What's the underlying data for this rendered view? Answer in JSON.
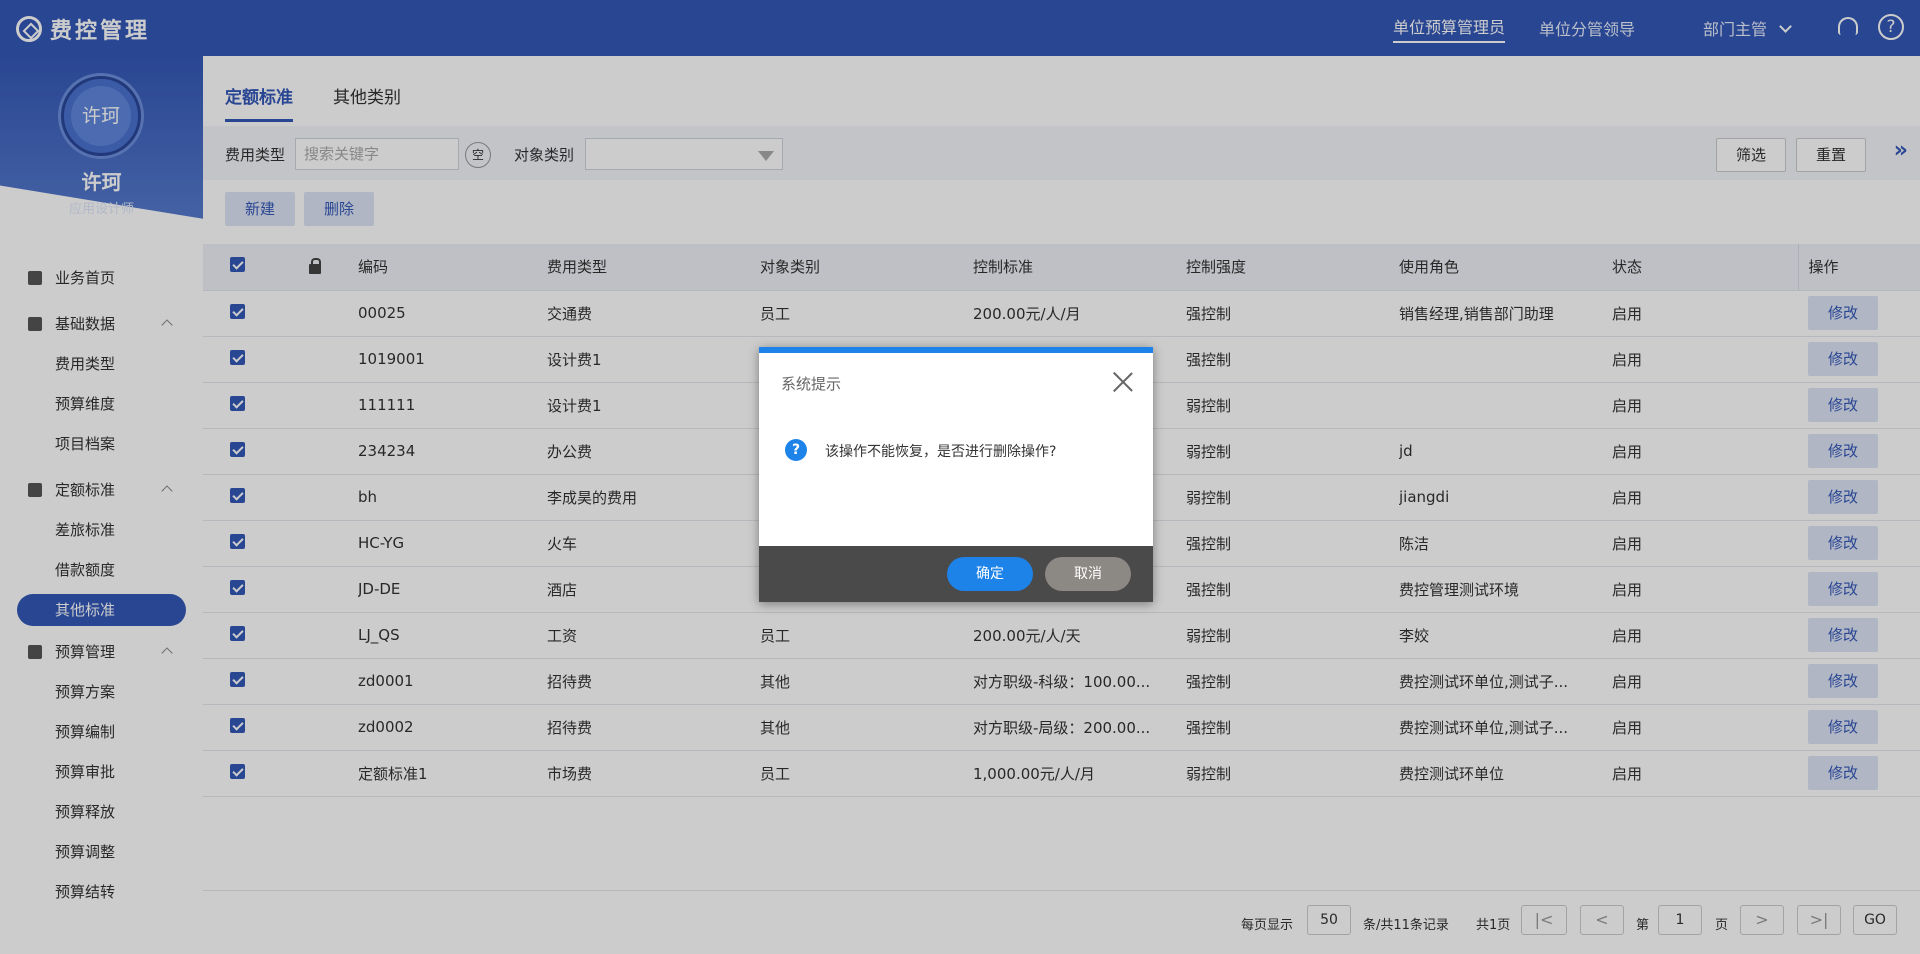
{
  "app": {
    "title": "费控管理"
  },
  "topnav": {
    "items": [
      "单位预算管理员",
      "单位分管领导",
      "部门主管"
    ]
  },
  "user": {
    "avatar_text": "许珂",
    "name": "许珂",
    "role": "应用设计师"
  },
  "sidebar": {
    "home": "业务首页",
    "groups": [
      {
        "label": "基础数据",
        "items": [
          "费用类型",
          "预算维度",
          "项目档案"
        ]
      },
      {
        "label": "定额标准",
        "items": [
          "差旅标准",
          "借款额度",
          "其他标准"
        ]
      },
      {
        "label": "预算管理",
        "items": [
          "预算方案",
          "预算编制",
          "预算审批",
          "预算释放",
          "预算调整",
          "预算结转"
        ]
      }
    ],
    "active_item": "其他标准"
  },
  "tabs": [
    "定额标准",
    "其他类别"
  ],
  "filter": {
    "expense_label": "费用类型",
    "expense_placeholder": "搜索关键字",
    "clear_label": "空",
    "object_label": "对象类别",
    "filter_btn": "筛选",
    "reset_btn": "重置",
    "expand": "»"
  },
  "actions": {
    "new": "新建",
    "delete": "删除"
  },
  "table": {
    "headers": [
      "编码",
      "费用类型",
      "对象类别",
      "控制标准",
      "控制强度",
      "使用角色",
      "状态",
      "操作"
    ],
    "edit_label": "修改",
    "rows": [
      [
        "00025",
        "交通费",
        "员工",
        "200.00元/人/月",
        "强控制",
        "销售经理,销售部门助理",
        "启用"
      ],
      [
        "1019001",
        "设计费1",
        "",
        "",
        "强控制",
        "",
        "启用"
      ],
      [
        "111111",
        "设计费1",
        "",
        "",
        "弱控制",
        "",
        "启用"
      ],
      [
        "234234",
        "办公费",
        "",
        "",
        "弱控制",
        "jd",
        "启用"
      ],
      [
        "bh",
        "李成昊的费用",
        "",
        "",
        "弱控制",
        "jiangdi",
        "启用"
      ],
      [
        "HC-YG",
        "火车",
        "",
        "",
        "强控制",
        "陈洁",
        "启用"
      ],
      [
        "JD-DE",
        "酒店",
        "",
        "",
        "强控制",
        "费控管理测试环境",
        "启用"
      ],
      [
        "LJ_QS",
        "工资",
        "员工",
        "200.00元/人/天",
        "弱控制",
        "李姣",
        "启用"
      ],
      [
        "zd0001",
        "招待费",
        "其他",
        "对方职级-科级：100.00...",
        "强控制",
        "费控测试环单位,测试子...",
        "启用"
      ],
      [
        "zd0002",
        "招待费",
        "其他",
        "对方职级-局级：200.00...",
        "强控制",
        "费控测试环单位,测试子...",
        "启用"
      ],
      [
        "定额标准1",
        "市场费",
        "员工",
        "1,000.00元/人/月",
        "弱控制",
        "费控测试环单位",
        "启用"
      ]
    ]
  },
  "pager": {
    "per_page_label": "每页显示",
    "per_page": "50",
    "records": "条/共11条记录",
    "pages": "共1页",
    "page_prefix": "第",
    "page": "1",
    "page_suffix": "页",
    "go": "GO"
  },
  "dialog": {
    "title": "系统提示",
    "message": "该操作不能恢复，是否进行删除操作?",
    "confirm": "确定",
    "cancel": "取消"
  },
  "colors": {
    "primary": "#3458b8",
    "dialog_accent": "#1e83e8",
    "dialog_footer": "#4a4a4a"
  }
}
